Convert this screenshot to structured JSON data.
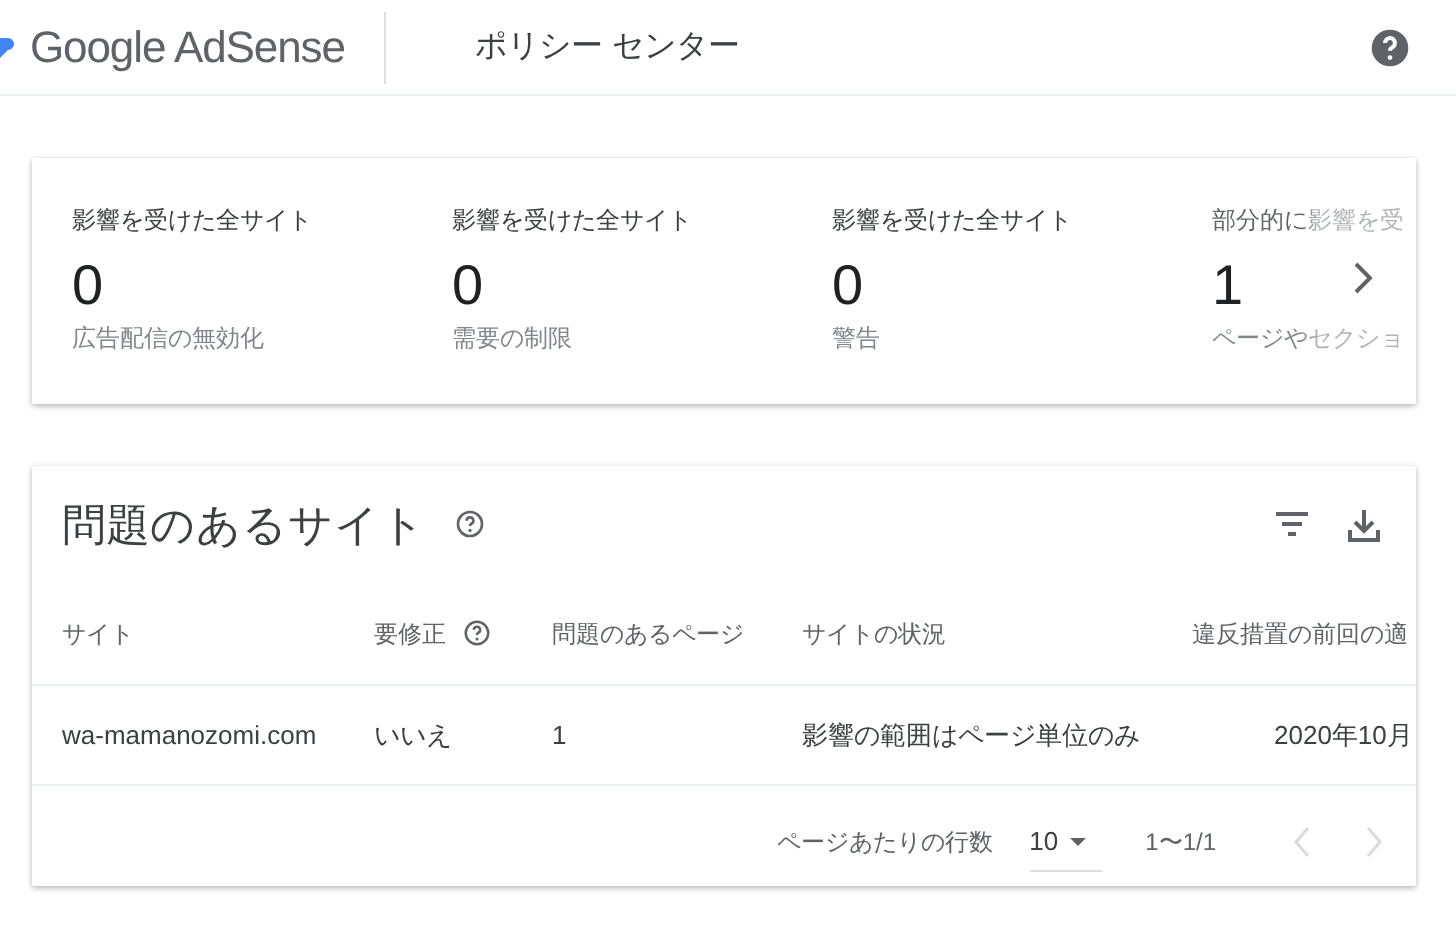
{
  "header": {
    "logo": "Google AdSense",
    "title": "ポリシー センター"
  },
  "summary": {
    "cards": [
      {
        "label": "影響を受けた全サイト",
        "count": "0",
        "caption": "広告配信の無効化",
        "faded": false
      },
      {
        "label": "影響を受けた全サイト",
        "count": "0",
        "caption": "需要の制限",
        "faded": false
      },
      {
        "label": "影響を受けた全サイト",
        "count": "0",
        "caption": "警告",
        "faded": false
      },
      {
        "label": "部分的に影響を受",
        "count": "1",
        "caption": "ページやセクショ",
        "faded": true
      }
    ]
  },
  "table": {
    "title": "問題のあるサイト",
    "columns": [
      {
        "label": "サイト",
        "help": false
      },
      {
        "label": "要修正",
        "help": true
      },
      {
        "label": "問題のあるページ",
        "help": false
      },
      {
        "label": "サイトの状況",
        "help": false
      },
      {
        "label": "違反措置の前回の適",
        "help": false
      }
    ],
    "rows": [
      [
        "wa-mamanozomi.com",
        "いいえ",
        "1",
        "影響の範囲はページ単位のみ",
        "2020年10月"
      ]
    ],
    "pagination": {
      "rows_per_page_label": "ページあたりの行数",
      "rows_per_page": "10",
      "range": "1〜1/1",
      "prev_disabled": true,
      "next_disabled": true
    }
  }
}
